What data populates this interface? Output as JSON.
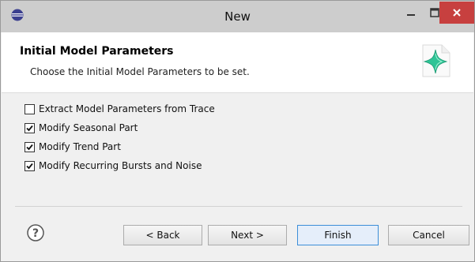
{
  "window": {
    "title": "New"
  },
  "header": {
    "title": "Initial Model Parameters",
    "description": "Choose the Initial Model Parameters to be set."
  },
  "options": [
    {
      "label": "Extract Model Parameters from Trace",
      "checked": false
    },
    {
      "label": "Modify Seasonal Part",
      "checked": true
    },
    {
      "label": "Modify Trend Part",
      "checked": true
    },
    {
      "label": "Modify Recurring Bursts and Noise",
      "checked": true
    }
  ],
  "buttons": {
    "back": "< Back",
    "next": "Next >",
    "finish": "Finish",
    "cancel": "Cancel"
  },
  "colors": {
    "close_button": "#c7403f",
    "titlebar": "#cdcdcd",
    "accent_icon": "#2ec496"
  }
}
